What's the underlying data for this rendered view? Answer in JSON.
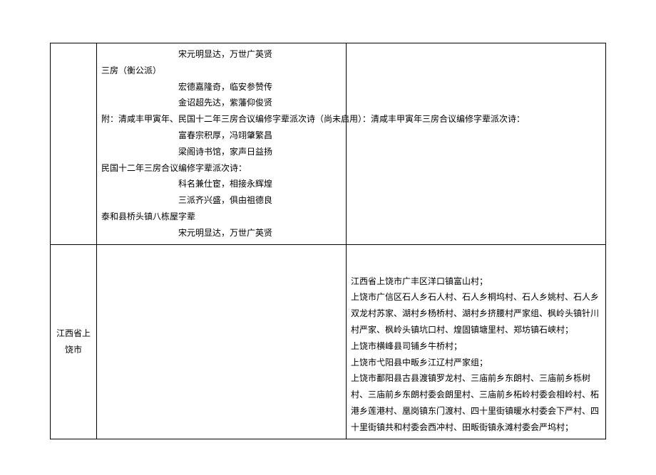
{
  "row1": {
    "label": "",
    "middle": {
      "lines": [
        {
          "text": "宋元明显达，万世广英贤",
          "cls": "indent-poem"
        },
        {
          "text": "三房（衡公派）",
          "cls": "indent-small"
        },
        {
          "text": "宏德嘉隆奇，临安参赞传",
          "cls": "indent-poem"
        },
        {
          "text": "金诏超先达，紫藩仰俊贤",
          "cls": "indent-poem"
        },
        {
          "text": "附：清咸丰甲寅年、民国十二年三房合议编修字辈派次诗（尚未启用）：清咸丰甲寅年三房合议编修字辈派次诗：",
          "cls": "indent-small"
        },
        {
          "text": "富春宗积厚，冯翊肇繁昌",
          "cls": "indent-poem"
        },
        {
          "text": "梁阁诗书馆，家声日益扬",
          "cls": "indent-poem"
        },
        {
          "text": "民国十二年三房合议编修字辈派次诗：",
          "cls": "indent-small"
        },
        {
          "text": "科名兼仕宦，相接永辉煌",
          "cls": "indent-poem"
        },
        {
          "text": "三派齐兴盛，俱由祖德良",
          "cls": "indent-poem"
        },
        {
          "text": "泰和县桥头镇八栋屋字辈",
          "cls": "indent-small"
        },
        {
          "text": "宋元明显达，万世广英贤",
          "cls": "indent-poem"
        }
      ]
    },
    "right": ""
  },
  "row2": {
    "label": "江西省上饶市",
    "middle": "",
    "right": {
      "lines": [
        "江西省上饶市广丰区洋口镇富山村；",
        "上饶市广信区石人乡石人村、石人乡桐坞村、石人乡姚村、石人乡双龙村苏家、湖村乡杨桥村、湖村乡挤腰村严家组、枫岭头镇针川村严家、枫岭头镇坑口村、煌固镇塘里村、郑坊镇石峡村；",
        "上饶市横峰县司铺乡牛桥村；",
        "上饶市弋阳县中畈乡江辽村严家组；",
        "上饶市鄱阳县古县渡镇罗龙村、三庙前乡东朗村、三庙前乡栎树村、三庙前乡东朗村委会朗里村、三庙前乡柘岭村委会相岭村、柘港乡莲港村、凰岗镇东门渡村、四十里街镇暖水村委会下严村、四十里街镇共和村委会西冲村、田畈街镇永滩村委会严坞村；"
      ]
    }
  }
}
